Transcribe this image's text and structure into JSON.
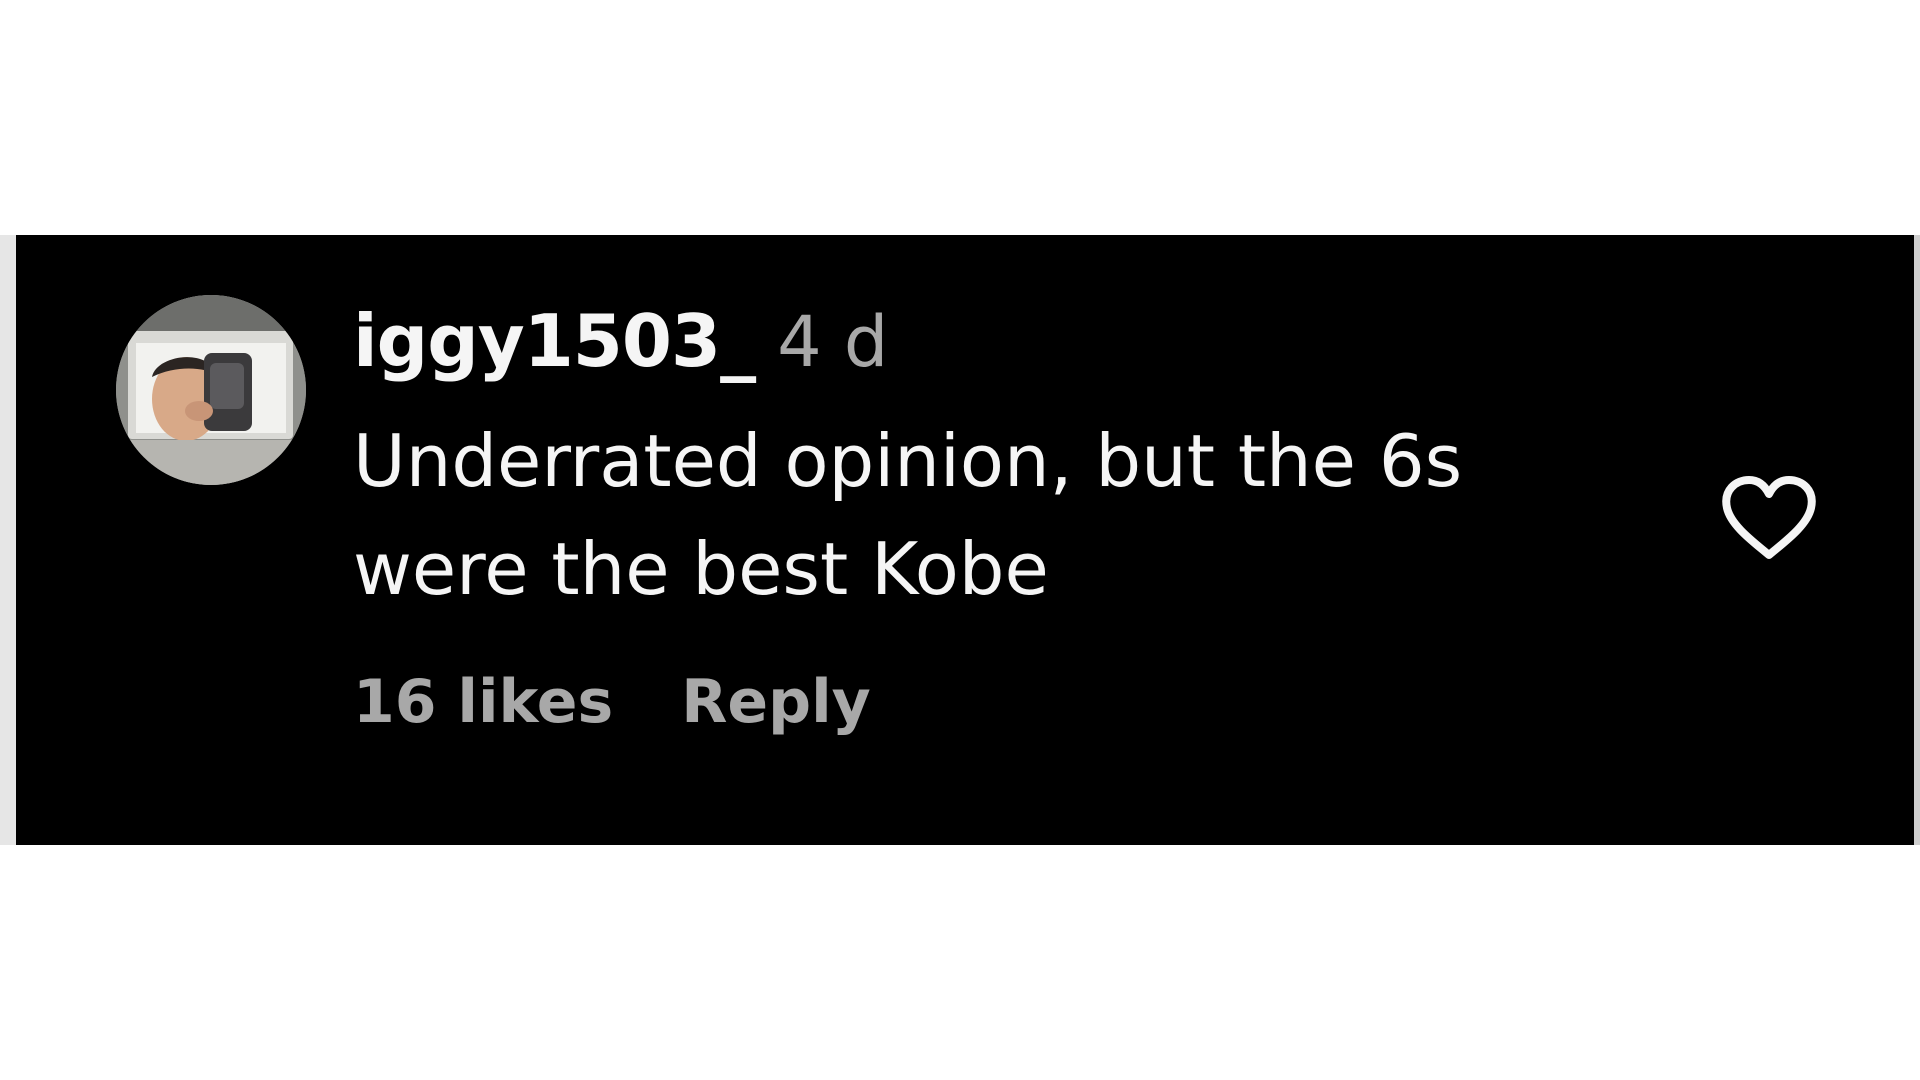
{
  "comment": {
    "username": "iggy1503_",
    "timestamp": "4 d",
    "text_line_1": "Underrated opinion, but the 6s",
    "text_line_2": "were the best Kobe",
    "likes_label": "16 likes",
    "reply_label": "Reply",
    "avatar_icon": "profile-photo",
    "like_icon": "heart-outline-icon"
  },
  "colors": {
    "background": "#000000",
    "primary_text": "#f5f5f5",
    "secondary_text": "#a8a8a8",
    "page_background": "#ffffff"
  }
}
